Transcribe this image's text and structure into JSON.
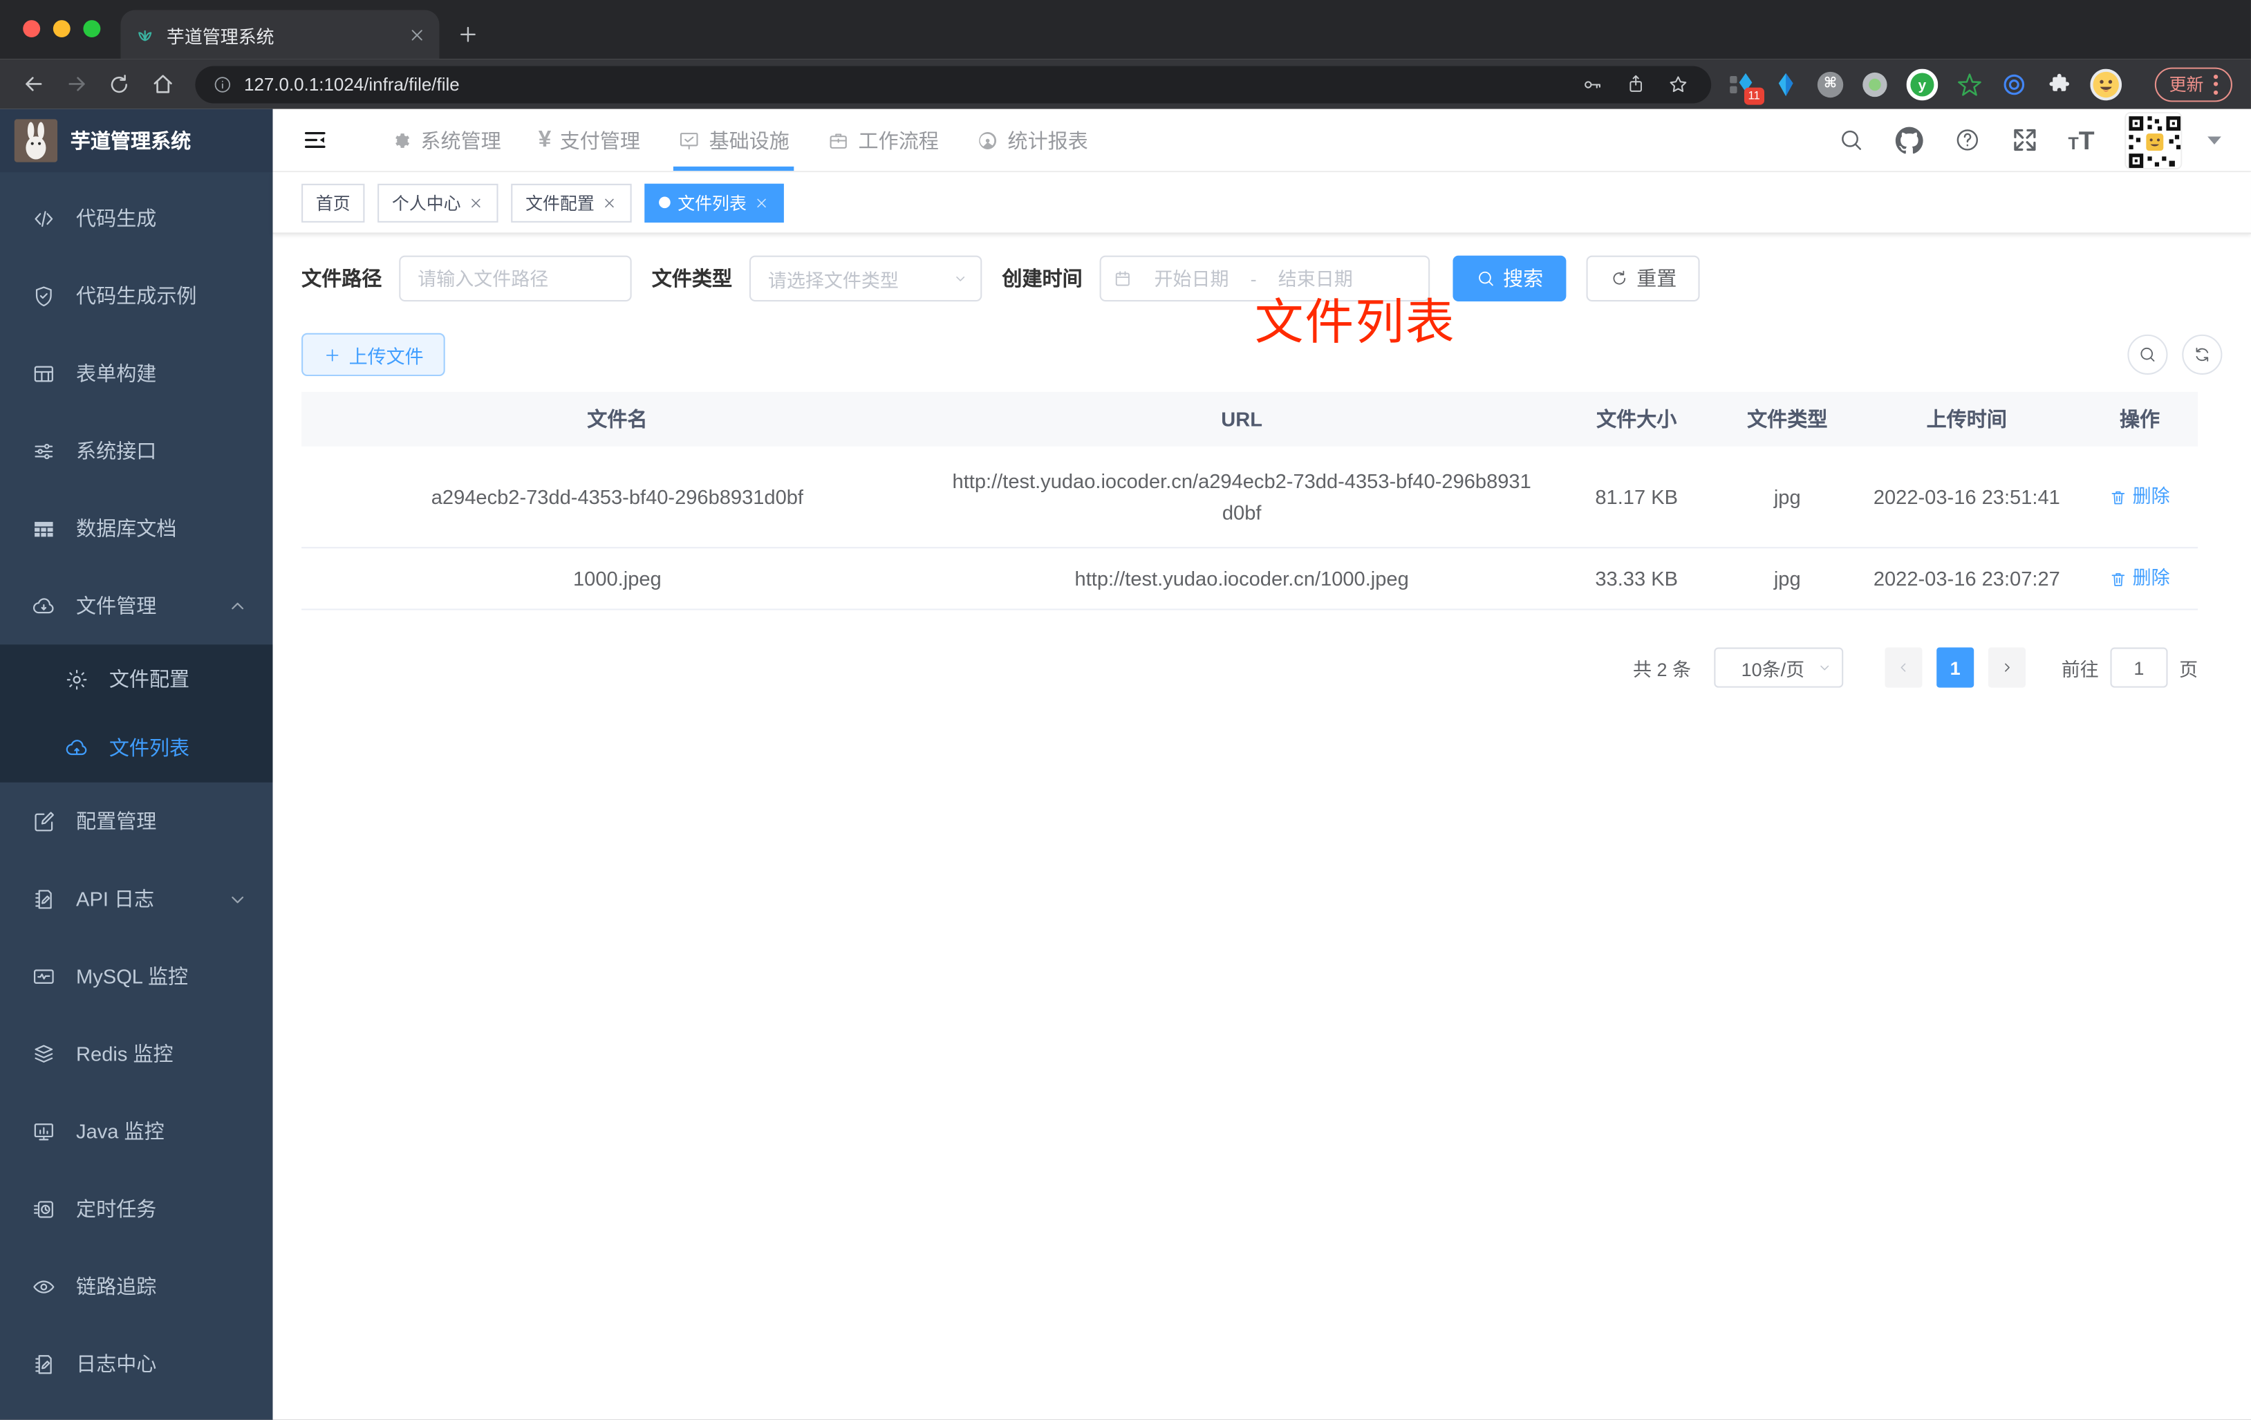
{
  "browser": {
    "tab_title": "芋道管理系统",
    "url": "127.0.0.1:1024/infra/file/file",
    "update_label": "更新",
    "ext_badge": "11"
  },
  "icons": {
    "yen": "¥",
    "cmd": "⌘",
    "y_logo": "y",
    "font_big": "T",
    "font_small": "T"
  },
  "header": {
    "app_title": "芋道管理系统",
    "nav": [
      {
        "label": "系统管理"
      },
      {
        "label": "支付管理"
      },
      {
        "label": "基础设施",
        "active": true
      },
      {
        "label": "工作流程"
      },
      {
        "label": "统计报表"
      }
    ]
  },
  "sidebar": {
    "items": [
      {
        "label": "代码生成"
      },
      {
        "label": "代码生成示例"
      },
      {
        "label": "表单构建"
      },
      {
        "label": "系统接口"
      },
      {
        "label": "数据库文档"
      },
      {
        "label": "文件管理",
        "expanded": true
      },
      {
        "label": "文件配置",
        "sub": true
      },
      {
        "label": "文件列表",
        "sub": true,
        "active": true
      },
      {
        "label": "配置管理"
      },
      {
        "label": "API 日志",
        "collapsed": true
      },
      {
        "label": "MySQL 监控"
      },
      {
        "label": "Redis 监控"
      },
      {
        "label": "Java 监控"
      },
      {
        "label": "定时任务"
      },
      {
        "label": "链路追踪"
      },
      {
        "label": "日志中心"
      }
    ]
  },
  "tags": [
    {
      "label": "首页"
    },
    {
      "label": "个人中心"
    },
    {
      "label": "文件配置"
    },
    {
      "label": "文件列表",
      "active": true
    }
  ],
  "annotation": "文件列表",
  "filters": {
    "path_label": "文件路径",
    "path_placeholder": "请输入文件路径",
    "type_label": "文件类型",
    "type_placeholder": "请选择文件类型",
    "date_label": "创建时间",
    "date_start": "开始日期",
    "date_sep": "-",
    "date_end": "结束日期",
    "search": "搜索",
    "reset": "重置"
  },
  "actions": {
    "upload": "上传文件"
  },
  "table": {
    "headers": [
      "文件名",
      "URL",
      "文件大小",
      "文件类型",
      "上传时间",
      "操作"
    ],
    "rows": [
      {
        "name": "a294ecb2-73dd-4353-bf40-296b8931d0bf",
        "url": "http://test.yudao.iocoder.cn/a294ecb2-73dd-4353-bf40-296b8931d0bf",
        "size": "81.17 KB",
        "type": "jpg",
        "time": "2022-03-16 23:51:41",
        "action": "删除"
      },
      {
        "name": "1000.jpeg",
        "url": "http://test.yudao.iocoder.cn/1000.jpeg",
        "size": "33.33 KB",
        "type": "jpg",
        "time": "2022-03-16 23:07:27",
        "action": "删除"
      }
    ]
  },
  "pagination": {
    "total": "共 2 条",
    "page_size": "10条/页",
    "current": "1",
    "goto": "前往",
    "page_unit": "页"
  }
}
